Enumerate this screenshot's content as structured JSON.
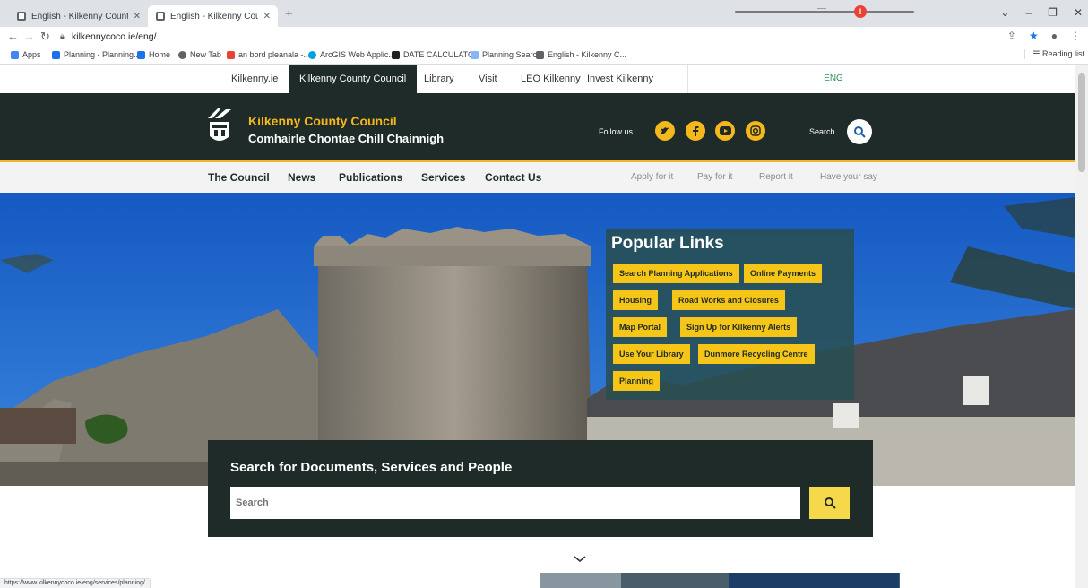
{
  "browser": {
    "tabs": [
      {
        "title": "English - Kilkenny County Counc",
        "close": "✕"
      },
      {
        "title": "English - Kilkenny County Counc",
        "close": "✕"
      }
    ],
    "new_tab": "+",
    "url": "kilkennycoco.ie/eng/",
    "bookmarks": [
      {
        "label": "Apps"
      },
      {
        "label": "Planning - Planning..."
      },
      {
        "label": "Home"
      },
      {
        "label": "New Tab"
      },
      {
        "label": "an bord pleanala -..."
      },
      {
        "label": "ArcGIS Web Applic..."
      },
      {
        "label": "DATE CALCULATOR"
      },
      {
        "label": "Planning Search"
      },
      {
        "label": "English - Kilkenny C..."
      }
    ],
    "reading_list": "Reading list",
    "status_url": "https://www.kilkennycoco.ie/eng/services/planning/"
  },
  "site": {
    "topnav": [
      {
        "label": "Kilkenny.ie"
      },
      {
        "label": "Kilkenny County Council"
      },
      {
        "label": "Library"
      },
      {
        "label": "Visit"
      },
      {
        "label": "LEO Kilkenny"
      },
      {
        "label": "Invest Kilkenny"
      }
    ],
    "language": "ENG",
    "brand_en": "Kilkenny County Council",
    "brand_ga": "Comhairle Chontae Chill Chainnigh",
    "follow_us": "Follow us",
    "search_label": "Search",
    "mainnav": [
      {
        "label": "The Council"
      },
      {
        "label": "News"
      },
      {
        "label": "Publications"
      },
      {
        "label": "Services"
      },
      {
        "label": "Contact Us"
      }
    ],
    "secondary_nav": [
      {
        "label": "Apply for it"
      },
      {
        "label": "Pay for it"
      },
      {
        "label": "Report it"
      },
      {
        "label": "Have your say"
      }
    ],
    "popular_title": "Popular Links",
    "popular_links": [
      {
        "label": "Search Planning Applications"
      },
      {
        "label": "Online Payments"
      },
      {
        "label": "Housing"
      },
      {
        "label": "Road Works and Closures"
      },
      {
        "label": "Map Portal"
      },
      {
        "label": "Sign Up for Kilkenny Alerts"
      },
      {
        "label": "Use Your Library"
      },
      {
        "label": "Dunmore Recycling Centre"
      },
      {
        "label": "Planning"
      }
    ],
    "search_heading": "Search for Documents, Services and People",
    "search_placeholder": "Search",
    "accent": "#f5b81c",
    "dark": "#1e2b28"
  }
}
